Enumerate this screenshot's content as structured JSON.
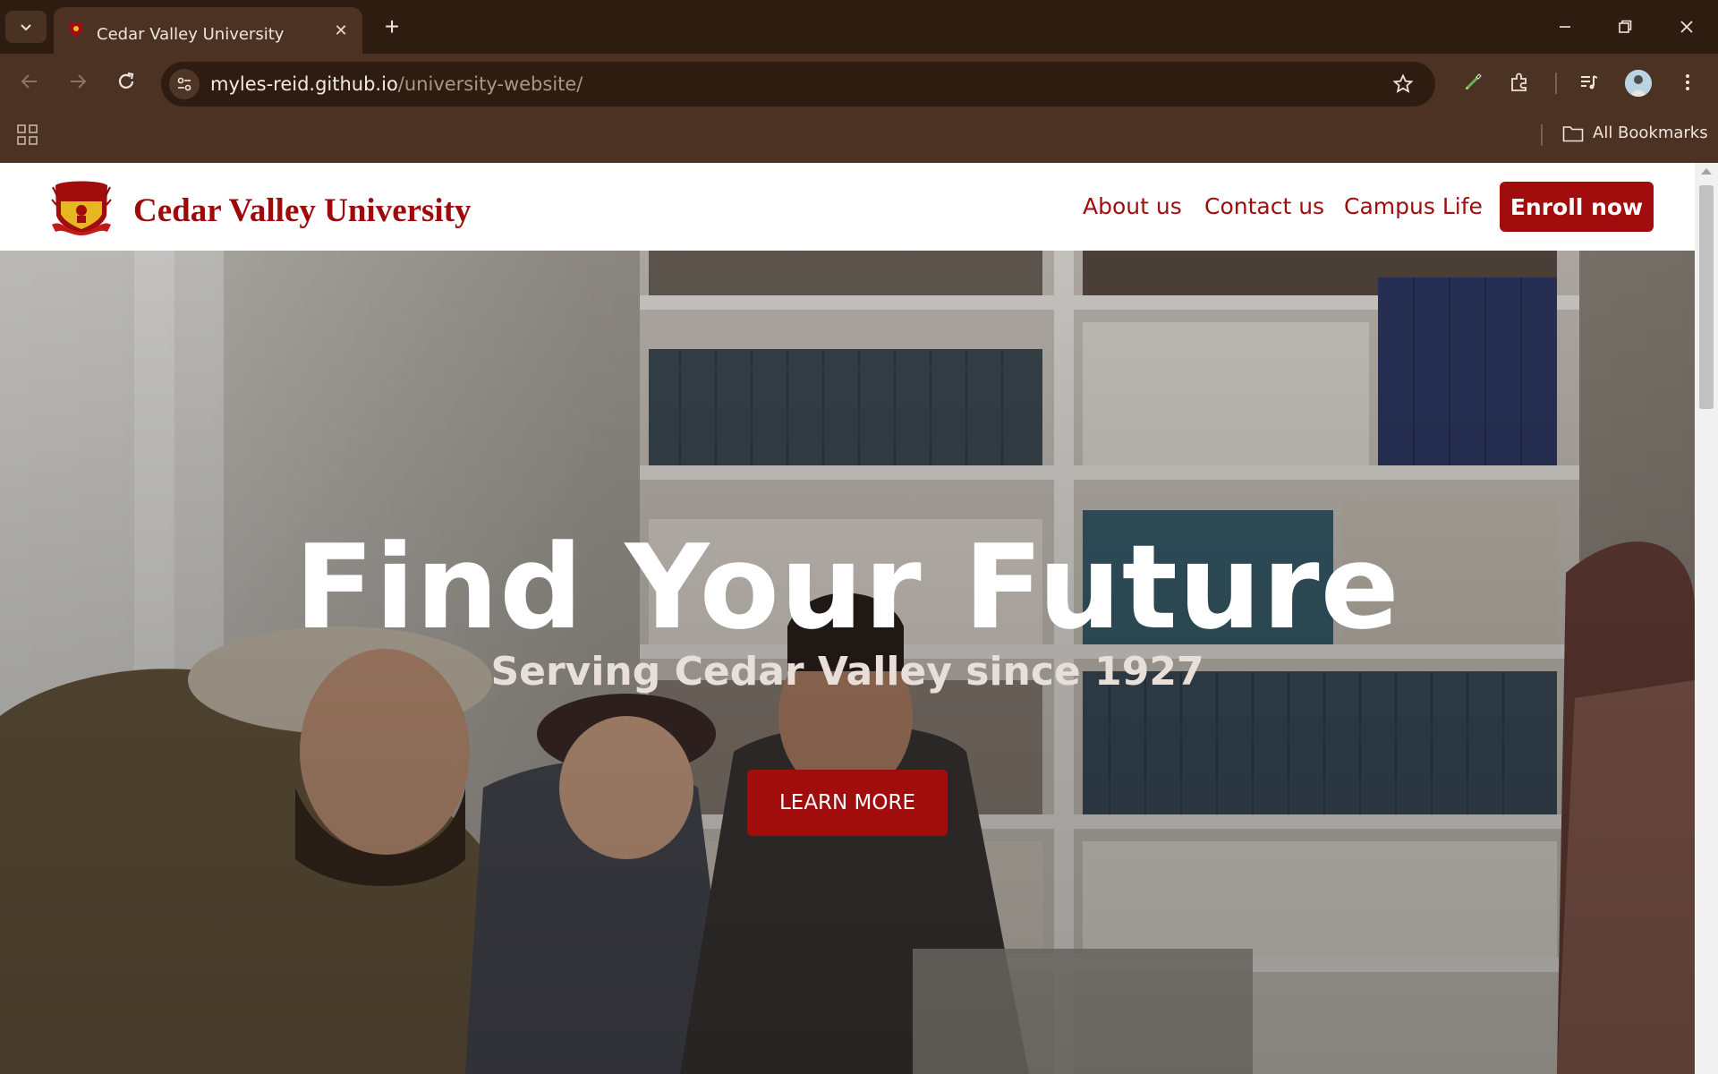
{
  "browser": {
    "tab_title": "Cedar Valley University",
    "url_host": "myles-reid.github.io",
    "url_path": "/university-website/",
    "bookmarks_label": "All Bookmarks"
  },
  "site": {
    "name": "Cedar Valley University",
    "nav": {
      "about": "About us",
      "contact": "Contact us",
      "campus": "Campus Life",
      "enroll": "Enroll now"
    },
    "hero": {
      "heading": "Find Your Future",
      "subheading": "Serving Cedar Valley since 1927",
      "button": "LEARN MORE"
    }
  },
  "colors": {
    "brand": "#a10c0c",
    "browser_frame": "#2e1c11",
    "browser_toolbar": "#4b3223"
  },
  "icons": [
    "tab-list-icon",
    "close-icon",
    "plus-icon",
    "minimize-icon",
    "restore-icon",
    "back-arrow-icon",
    "forward-arrow-icon",
    "reload-icon",
    "site-settings-icon",
    "star-icon",
    "pen-icon",
    "extensions-icon",
    "media-icon",
    "profile-avatar",
    "menu-icon",
    "apps-grid-icon",
    "folder-icon"
  ]
}
